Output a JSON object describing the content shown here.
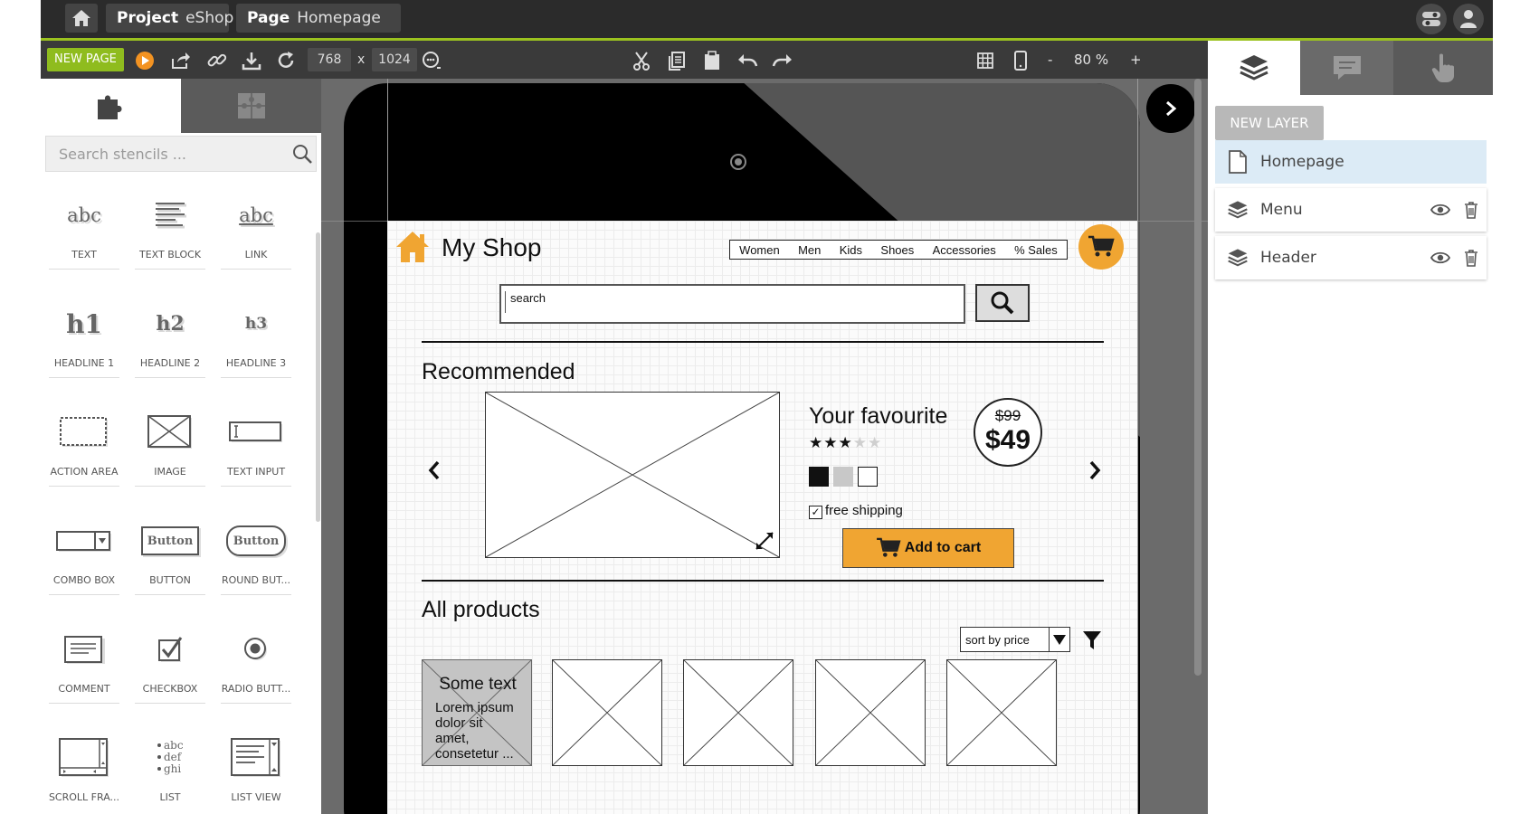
{
  "topbar": {
    "project_label": "Project",
    "project_value": "eShop",
    "page_label": "Page",
    "page_value": "Homepage"
  },
  "toolbar": {
    "new_page_label": "NEW PAGE",
    "width": "768",
    "times": "x",
    "height": "1024",
    "zoom_minus": "-",
    "zoom_value": "80 %",
    "zoom_plus": "+"
  },
  "stencils": {
    "search_placeholder": "Search stencils ...",
    "items": [
      {
        "label": "TEXT",
        "glyph": "abc"
      },
      {
        "label": "TEXT BLOCK"
      },
      {
        "label": "LINK",
        "glyph": "abc"
      },
      {
        "label": "HEADLINE 1",
        "glyph": "h1"
      },
      {
        "label": "HEADLINE 2",
        "glyph": "h2"
      },
      {
        "label": "HEADLINE 3",
        "glyph": "h3"
      },
      {
        "label": "ACTION AREA"
      },
      {
        "label": "IMAGE"
      },
      {
        "label": "TEXT INPUT",
        "glyph": "I"
      },
      {
        "label": "COMBO BOX"
      },
      {
        "label": "BUTTON",
        "glyph": "Button"
      },
      {
        "label": "ROUND BUT...",
        "glyph": "Button"
      },
      {
        "label": "COMMENT"
      },
      {
        "label": "CHECKBOX"
      },
      {
        "label": "RADIO BUTT..."
      },
      {
        "label": "SCROLL FRA..."
      },
      {
        "label": "LIST",
        "glyph": "abc,def,ghi"
      },
      {
        "label": "LIST VIEW"
      }
    ]
  },
  "mockup": {
    "shop_title": "My Shop",
    "nav": [
      "Women",
      "Men",
      "Kids",
      "Shoes",
      "Accessories",
      "% Sales"
    ],
    "search_text": "search",
    "recommended": "Recommended",
    "product_name": "Your favourite",
    "rating": 3,
    "rating_max": 5,
    "free_shipping": "free shipping",
    "add_to_cart": "Add to cart",
    "old_price": "$99",
    "new_price": "$49",
    "all_products": "All products",
    "sort_label": "sort by price",
    "card_title": "Some text",
    "card_body": "Lorem ipsum dolor sit amet, consetetur ..."
  },
  "layers": {
    "new_layer_label": "NEW LAYER",
    "items": [
      {
        "name": "Homepage",
        "selected": true
      },
      {
        "name": "Menu"
      },
      {
        "name": "Header"
      }
    ]
  },
  "colors": {
    "accent_green": "#9bc21f",
    "new_page_green": "#8fbc1e",
    "cart_orange": "#f0a532",
    "layer_selected": "#dcebf6",
    "dark_bar": "#2b2b2b",
    "panel_dark": "#3a3a3a"
  },
  "icons": [
    "home-icon",
    "chevron-down-icon",
    "toggle-icon",
    "user-icon",
    "play-icon",
    "share-icon",
    "link-icon",
    "download-icon",
    "refresh-icon",
    "smiley-icon",
    "cut-icon",
    "copy-icon",
    "paste-icon",
    "undo-icon",
    "redo-icon",
    "grid-icon",
    "phone-icon",
    "puzzle-icon",
    "search-icon",
    "layers-icon",
    "comment-icon",
    "hand-pointer-icon",
    "page-icon",
    "eye-icon",
    "trash-icon",
    "cart-icon",
    "chevron-left-icon",
    "chevron-right-icon",
    "filter-icon",
    "expand-icon"
  ]
}
